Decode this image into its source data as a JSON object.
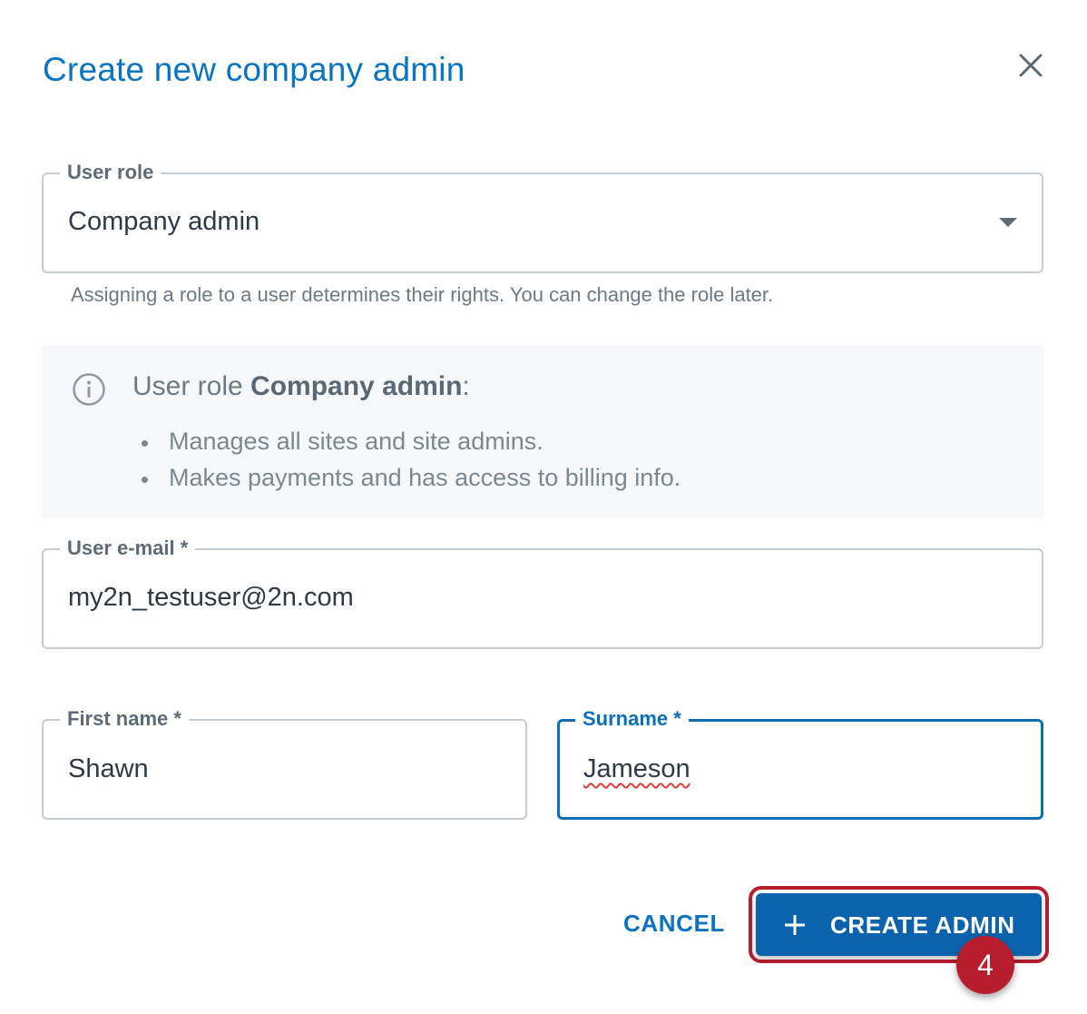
{
  "dialog": {
    "title": "Create new company admin",
    "close_icon": "close-icon"
  },
  "user_role": {
    "label": "User role",
    "value": "Company admin",
    "helper": "Assigning a role to a user determines their rights. You can change the role later."
  },
  "info": {
    "icon": "info-icon",
    "title_prefix": "User role ",
    "title_bold": "Company admin",
    "title_suffix": ":",
    "bullets": [
      "Manages all sites and site admins.",
      "Makes payments and has access to billing info."
    ]
  },
  "email": {
    "label": "User e-mail *",
    "value": "my2n_testuser@2n.com"
  },
  "first_name": {
    "label": "First name *",
    "value": "Shawn"
  },
  "surname": {
    "label": "Surname *",
    "value": "Jameson"
  },
  "actions": {
    "cancel_label": "CANCEL",
    "create_label": "CREATE ADMIN",
    "step_number": "4"
  },
  "colors": {
    "accent": "#0a74c2",
    "primary_button": "#0b63ad",
    "highlight": "#b81d2e",
    "spellcheck": "#e23b3b"
  }
}
